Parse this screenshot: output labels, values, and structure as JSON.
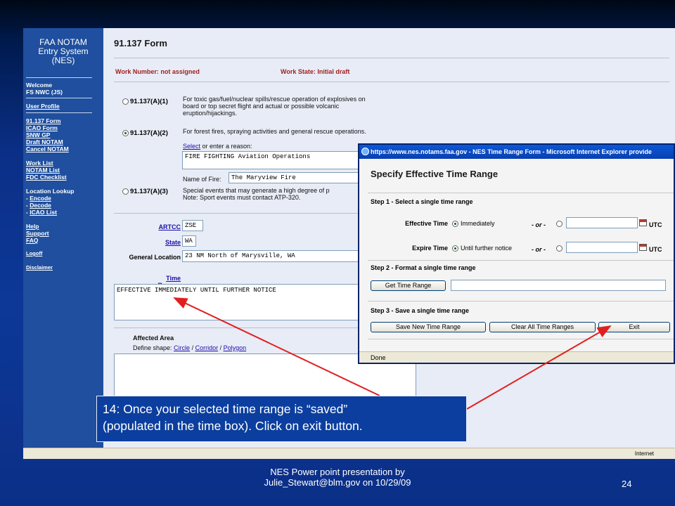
{
  "nav": {
    "brand": [
      "FAA NOTAM",
      "Entry System",
      "(NES)"
    ],
    "welcome": [
      "Welcome",
      "FS NWC (JS)"
    ],
    "items": [
      "User Profile",
      "91.137 Form",
      "ICAO Form",
      "SNW GP",
      "Draft NOTAM",
      "Cancel NOTAM",
      "Work List",
      "NOTAM List",
      "FDC Checklist"
    ],
    "location_lookup": "Location Lookup",
    "lookup_items": [
      "Encode",
      "Decode",
      "ICAO List"
    ],
    "help_items": [
      "Help",
      "Support",
      "FAQ"
    ],
    "logoff": "Logoff",
    "disclaimer": "Disclaimer"
  },
  "form": {
    "title": "91.137 Form",
    "work_number": "Work Number: not assigned",
    "work_state": "Work State: Initial draft",
    "options": [
      {
        "label": "91.137(A)(1)",
        "desc": [
          "For toxic gas/fuel/nuclear spills/rescue operation of explosives on",
          "board or top secret flight and actual or possible volcanic",
          "eruption/hijackings."
        ],
        "selected": false
      },
      {
        "label": "91.137(A)(2)",
        "desc": [
          "For forest fires, spraying activities and general rescue operations."
        ],
        "selected": true
      },
      {
        "label": "91.137(A)(3)",
        "desc": [
          "Special events that may generate a high degree of p",
          "Note: Sport events must contact ATP-320."
        ],
        "selected": false
      }
    ],
    "select_link": "Select",
    "select_text": " or enter a reason:",
    "reason_value": "FIRE FIGHTING Aviation Operations",
    "fire_label": "Name of Fire:",
    "fire_value": "The Maryview Fire",
    "artcc_label": "ARTCC",
    "artcc_value": "ZSE",
    "state_label": "State",
    "state_value": "WA",
    "location_label": "General Location",
    "location_value": "23 NM North of Marysville, WA",
    "time_ranges_label": "Time Ranges",
    "time_ranges_value": "EFFECTIVE IMMEDIATELY UNTIL FURTHER NOTICE",
    "affected_area": "Affected Area",
    "define_shape": "Define shape: ",
    "shapes": [
      "Circle",
      "Corridor",
      "Polygon"
    ],
    "shape_sep": " / "
  },
  "popup": {
    "title": "https://www.nes.notams.faa.gov - NES Time Range Form - Microsoft Internet Explorer provide",
    "heading": "Specify Effective Time Range",
    "step1": "Step 1 - Select a single time range",
    "effective_label": "Effective Time",
    "effective_option": "Immediately",
    "expire_label": "Expire Time",
    "expire_option": "Until further notice",
    "or_text": "- or -",
    "utc": "UTC",
    "step2": "Step 2 - Format a single time range",
    "get_button": "Get Time Range",
    "step3": "Step 3 - Save a single time range",
    "save_button": "Save New Time Range",
    "clear_button": "Clear All Time Ranges",
    "exit_button": "Exit",
    "status": "Done"
  },
  "browser_status": {
    "zone": "Internet"
  },
  "callout": {
    "line1": "14:  Once your selected time range is “saved”",
    "line2": "(populated in the time box). Click on exit button."
  },
  "footer": {
    "line1": "NES Power point presentation by",
    "line2": "Julie_Stewart@blm.gov on 10/29/09",
    "page": "24"
  },
  "colors": {
    "nav_bg": "#1f4f9e",
    "accent_red": "#a0211f",
    "callout_bg": "#0b3e9e",
    "arrow": "#e02020"
  }
}
